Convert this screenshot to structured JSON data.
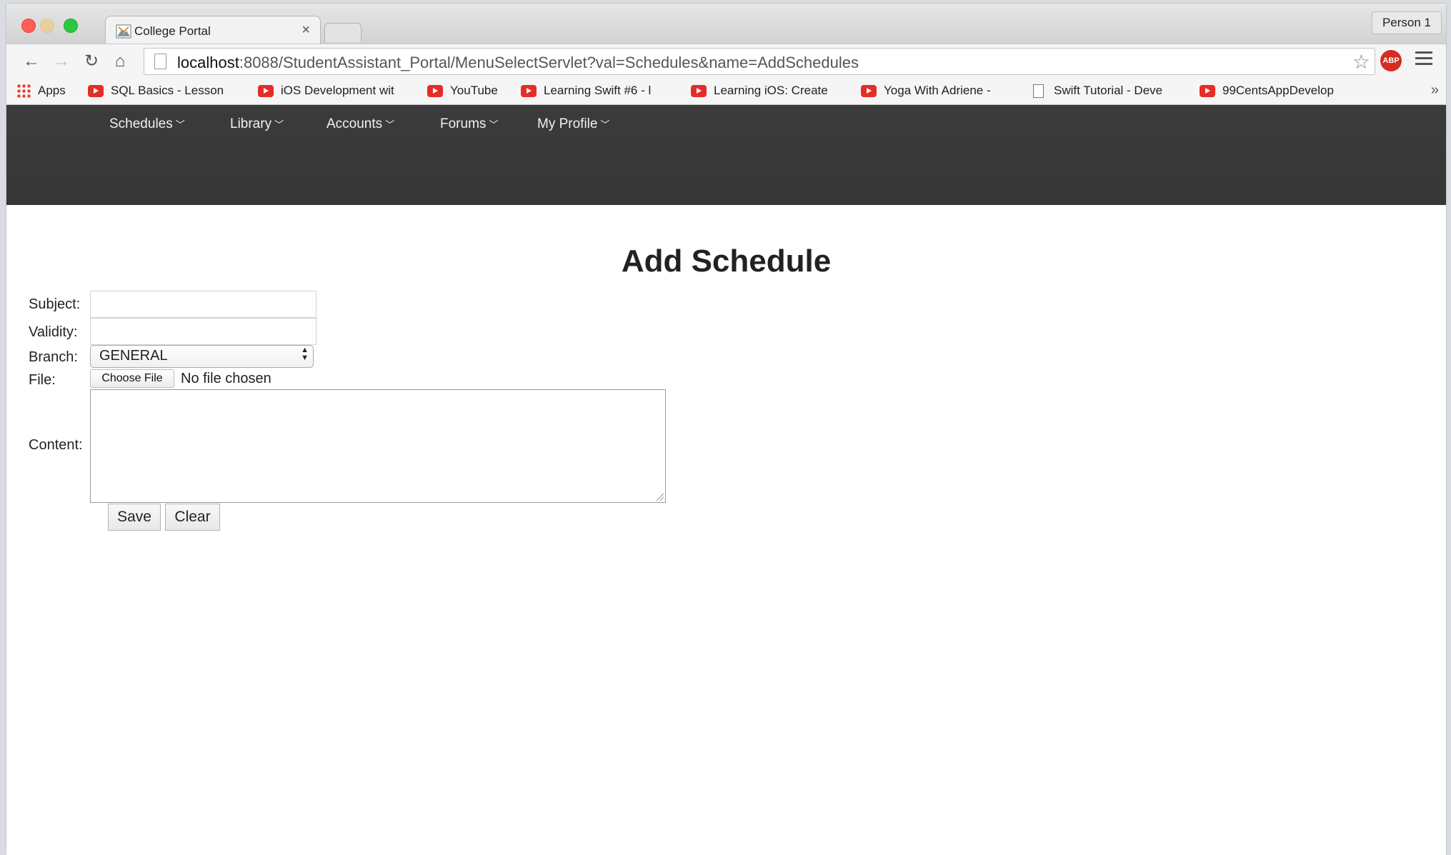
{
  "browser": {
    "tab_title": "College Portal",
    "tab_close": "×",
    "profile": "Person 1",
    "url_host": "localhost",
    "url_rest": ":8088/StudentAssistant_Portal/MenuSelectServlet?val=Schedules&name=AddSchedules",
    "abp_label": "ABP",
    "bookmarks": [
      {
        "label": "Apps",
        "icon": "apps-grid-icon"
      },
      {
        "label": "SQL Basics - Lesson",
        "icon": "youtube-icon"
      },
      {
        "label": "iOS Development wit",
        "icon": "youtube-icon"
      },
      {
        "label": "YouTube",
        "icon": "youtube-icon"
      },
      {
        "label": "Learning Swift #6 - l",
        "icon": "youtube-icon"
      },
      {
        "label": "Learning iOS: Create",
        "icon": "youtube-icon"
      },
      {
        "label": "Yoga With Adriene -",
        "icon": "youtube-icon"
      },
      {
        "label": "Swift Tutorial - Deve",
        "icon": "document-icon"
      },
      {
        "label": "99CentsAppDevelop",
        "icon": "youtube-icon"
      }
    ],
    "bookmarks_overflow": "»"
  },
  "site_nav": {
    "items": [
      "Schedules",
      "Library",
      "Accounts",
      "Forums",
      "My Profile"
    ]
  },
  "form": {
    "title": "Add Schedule",
    "subject_label": "Subject:",
    "subject_value": "",
    "validity_label": "Validity:",
    "validity_value": "",
    "branch_label": "Branch:",
    "branch_selected": "GENERAL",
    "file_label": "File:",
    "choose_file_label": "Choose File",
    "file_status": "No file chosen",
    "content_label": "Content:",
    "content_value": "",
    "save_label": "Save",
    "clear_label": "Clear"
  },
  "colors": {
    "banner": "#3a3a3a",
    "nav_text": "#f1f1f1",
    "youtube_red": "#e52d27",
    "abp_red": "#d62d20"
  }
}
